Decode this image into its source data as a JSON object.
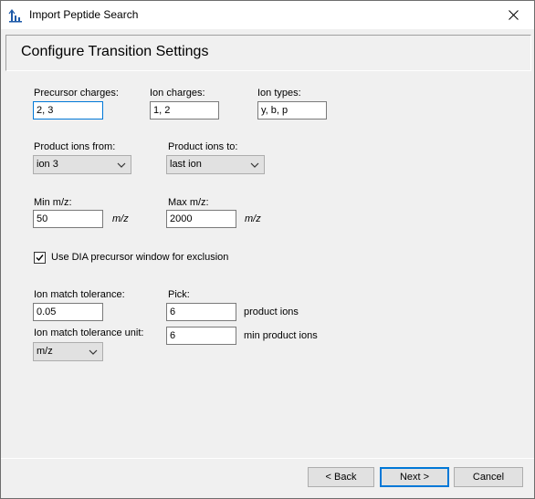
{
  "window": {
    "title": "Import Peptide Search"
  },
  "header": {
    "title": "Configure Transition Settings"
  },
  "form": {
    "precursor_charges": {
      "label": "Precursor charges:",
      "value": "2, 3"
    },
    "ion_charges": {
      "label": "Ion charges:",
      "value": "1, 2"
    },
    "ion_types": {
      "label": "Ion types:",
      "value": "y, b, p"
    },
    "product_ions_from": {
      "label": "Product ions from:",
      "value": "ion 3"
    },
    "product_ions_to": {
      "label": "Product ions to:",
      "value": "last ion"
    },
    "min_mz": {
      "label": "Min m/z:",
      "value": "50",
      "unit": "m/z"
    },
    "max_mz": {
      "label": "Max m/z:",
      "value": "2000",
      "unit": "m/z"
    },
    "dia_exclusion": {
      "label": "Use DIA precursor window for exclusion",
      "checked": true
    },
    "ion_match_tolerance": {
      "label": "Ion match tolerance:",
      "value": "0.05"
    },
    "ion_match_tolerance_unit": {
      "label": "Ion match tolerance unit:",
      "value": "m/z"
    },
    "pick": {
      "label": "Pick:",
      "value": "6",
      "suffix": "product ions"
    },
    "min_product_ions": {
      "value": "6",
      "suffix": "min product ions"
    }
  },
  "buttons": {
    "back": "< Back",
    "next": "Next >",
    "cancel": "Cancel"
  },
  "icons": {
    "app": "peptide-chart-icon",
    "close": "close-icon",
    "dropdown": "chevron-down-icon",
    "check": "checkmark-icon"
  },
  "colors": {
    "focus": "#0078d7",
    "icon": "#1e5aa8"
  }
}
